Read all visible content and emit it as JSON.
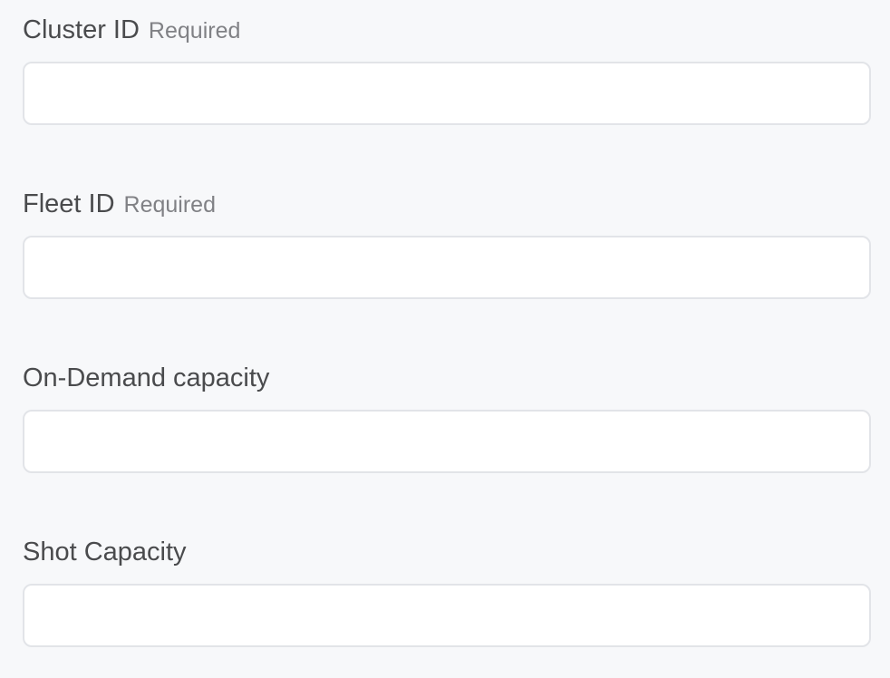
{
  "form": {
    "fields": [
      {
        "label": "Cluster ID",
        "required_text": "Required",
        "value": "",
        "placeholder": ""
      },
      {
        "label": "Fleet ID",
        "required_text": "Required",
        "value": "",
        "placeholder": ""
      },
      {
        "label": "On-Demand capacity",
        "required_text": "",
        "value": "",
        "placeholder": ""
      },
      {
        "label": "Shot Capacity",
        "required_text": "",
        "value": "",
        "placeholder": ""
      }
    ]
  },
  "colors": {
    "background": "#f7f8fa",
    "label": "#4a4b4d",
    "required": "#808185",
    "input_border": "#e2e4e8",
    "input_background": "#ffffff"
  }
}
